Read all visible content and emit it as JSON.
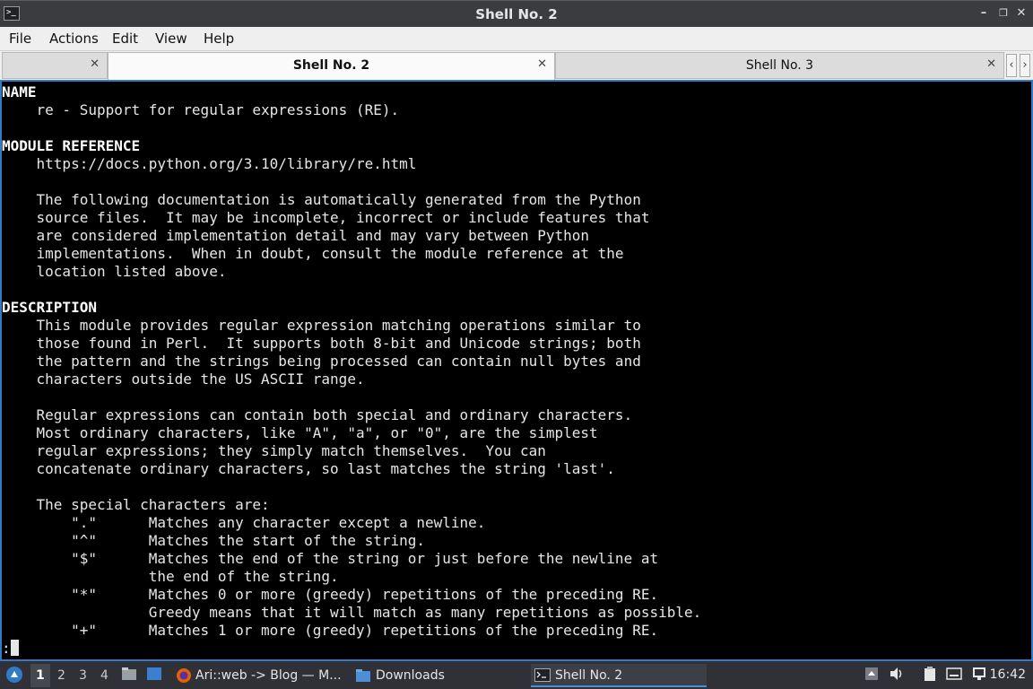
{
  "window": {
    "title": "Shell No. 2",
    "icon_name": "terminal-icon",
    "buttons": {
      "minimize": "–",
      "restore": "❐",
      "close": "✕"
    }
  },
  "menu": [
    "File",
    "Actions",
    "Edit",
    "View",
    "Help"
  ],
  "tabs": [
    {
      "label": "",
      "active": false
    },
    {
      "label": "Shell No. 2",
      "active": true
    },
    {
      "label": "Shell No. 3",
      "active": false
    }
  ],
  "tab_close_glyph": "✕",
  "terminal": {
    "lines": [
      {
        "bold": true,
        "text": "NAME"
      },
      {
        "bold": false,
        "text": "    re - Support for regular expressions (RE)."
      },
      {
        "bold": false,
        "text": ""
      },
      {
        "bold": true,
        "text": "MODULE REFERENCE"
      },
      {
        "bold": false,
        "text": "    https://docs.python.org/3.10/library/re.html"
      },
      {
        "bold": false,
        "text": ""
      },
      {
        "bold": false,
        "text": "    The following documentation is automatically generated from the Python"
      },
      {
        "bold": false,
        "text": "    source files.  It may be incomplete, incorrect or include features that"
      },
      {
        "bold": false,
        "text": "    are considered implementation detail and may vary between Python"
      },
      {
        "bold": false,
        "text": "    implementations.  When in doubt, consult the module reference at the"
      },
      {
        "bold": false,
        "text": "    location listed above."
      },
      {
        "bold": false,
        "text": ""
      },
      {
        "bold": true,
        "text": "DESCRIPTION"
      },
      {
        "bold": false,
        "text": "    This module provides regular expression matching operations similar to"
      },
      {
        "bold": false,
        "text": "    those found in Perl.  It supports both 8-bit and Unicode strings; both"
      },
      {
        "bold": false,
        "text": "    the pattern and the strings being processed can contain null bytes and"
      },
      {
        "bold": false,
        "text": "    characters outside the US ASCII range."
      },
      {
        "bold": false,
        "text": ""
      },
      {
        "bold": false,
        "text": "    Regular expressions can contain both special and ordinary characters."
      },
      {
        "bold": false,
        "text": "    Most ordinary characters, like \"A\", \"a\", or \"0\", are the simplest"
      },
      {
        "bold": false,
        "text": "    regular expressions; they simply match themselves.  You can"
      },
      {
        "bold": false,
        "text": "    concatenate ordinary characters, so last matches the string 'last'."
      },
      {
        "bold": false,
        "text": ""
      },
      {
        "bold": false,
        "text": "    The special characters are:"
      },
      {
        "bold": false,
        "text": "        \".\"      Matches any character except a newline."
      },
      {
        "bold": false,
        "text": "        \"^\"      Matches the start of the string."
      },
      {
        "bold": false,
        "text": "        \"$\"      Matches the end of the string or just before the newline at"
      },
      {
        "bold": false,
        "text": "                 the end of the string."
      },
      {
        "bold": false,
        "text": "        \"*\"      Matches 0 or more (greedy) repetitions of the preceding RE."
      },
      {
        "bold": false,
        "text": "                 Greedy means that it will match as many repetitions as possible."
      },
      {
        "bold": false,
        "text": "        \"+\"      Matches 1 or more (greedy) repetitions of the preceding RE."
      }
    ],
    "prompt": ":"
  },
  "taskbar": {
    "workspaces": [
      "1",
      "2",
      "3",
      "4"
    ],
    "active_workspace": "1",
    "tasks": [
      {
        "label": "Ari::web -> Blog — M...",
        "icon": "firefox-icon"
      },
      {
        "label": "Downloads",
        "icon": "folder-icon"
      },
      {
        "label": "Shell No. 2",
        "icon": "terminal-icon",
        "active": true
      }
    ],
    "clock": "16:42"
  },
  "colors": {
    "terminal_bg": "#000000",
    "terminal_fg": "#e6e6e6",
    "focus_border": "#2f7bc6",
    "titlebar_bg": "#3a3c40",
    "taskbar_bg": "#2f3136"
  }
}
